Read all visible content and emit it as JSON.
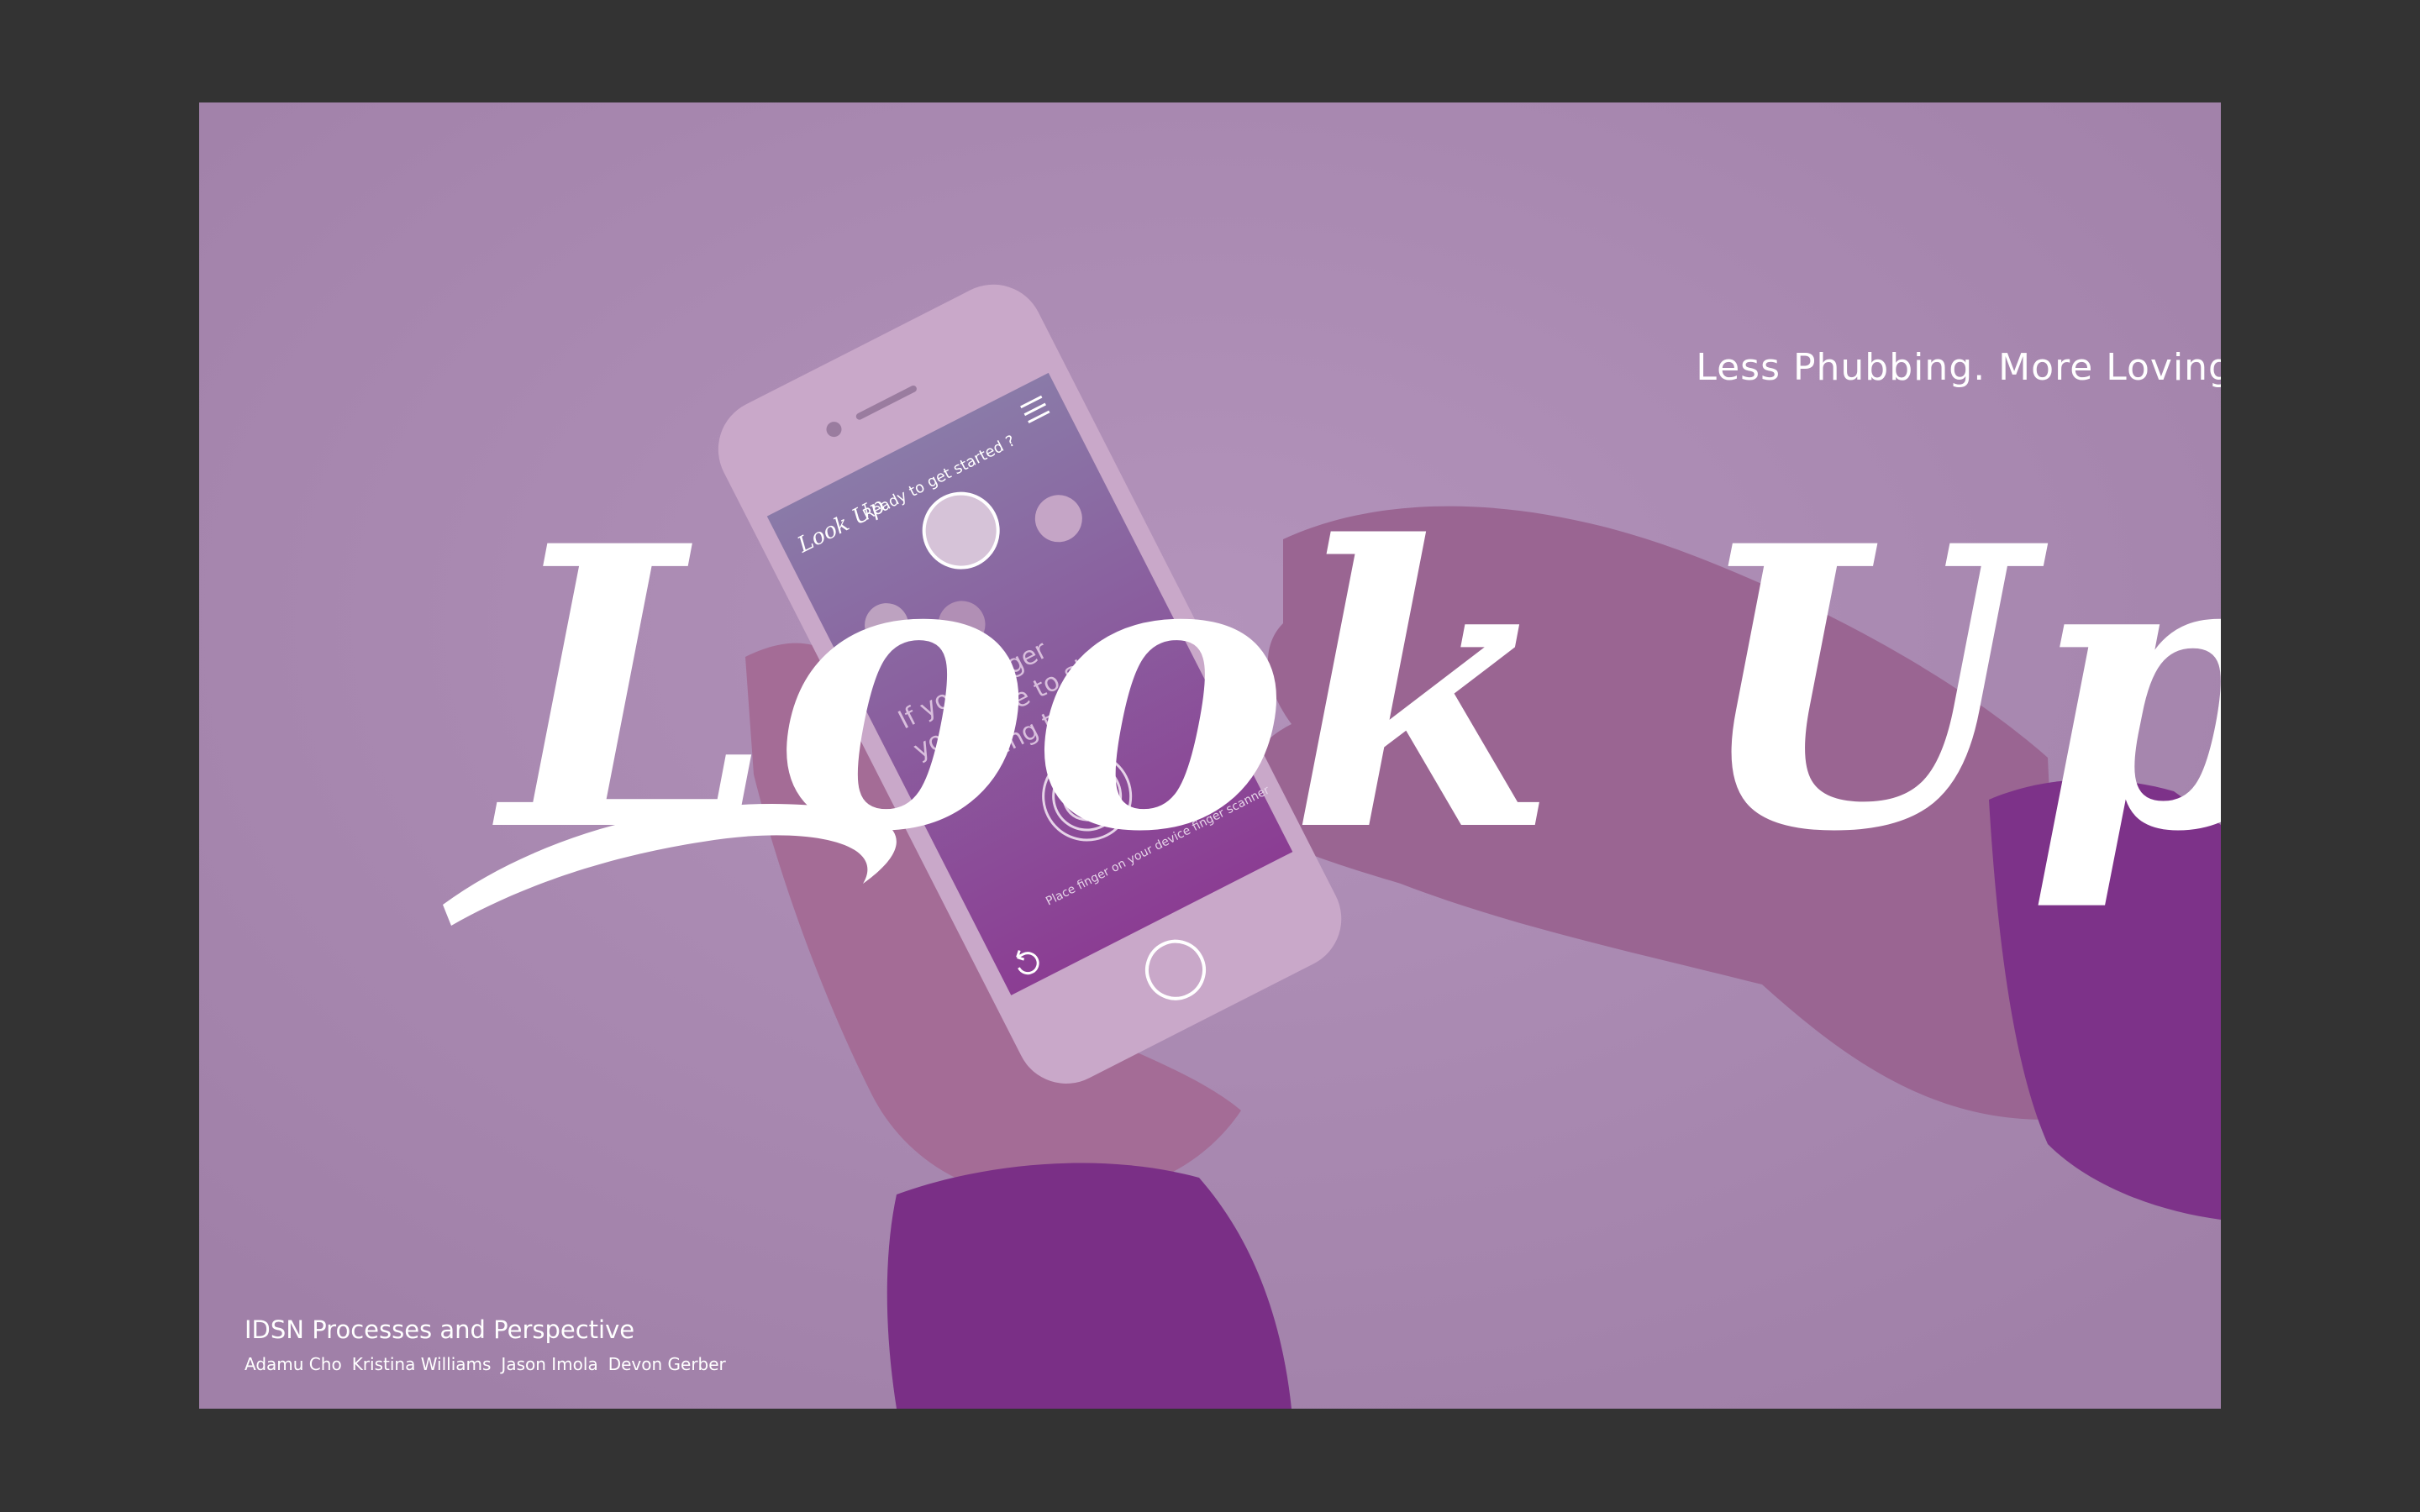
{
  "slide": {
    "tagline": "Less Phubbing. More Loving",
    "title": "Look Up",
    "course": "IDSN Processes and Perspective",
    "authors": [
      "Adamu Cho",
      "Kristina Williams",
      "Jason Imola",
      "Devon Gerber"
    ]
  },
  "phone_screen": {
    "logo": "Look Up",
    "prompt": "Ready to get started ?",
    "body_line1": "If your finger",
    "body_line2": "you agree to stop",
    "body_line3": "phubbing to start",
    "hint": "Place finger on your device finger scanner",
    "icons": [
      "menu-icon",
      "fingerprint-icon",
      "back-icon",
      "avatar-icon"
    ]
  },
  "colors": {
    "background": "#333333",
    "overlay": "#a685ad",
    "sleeve": "#7a2f86",
    "text": "#ffffff"
  }
}
